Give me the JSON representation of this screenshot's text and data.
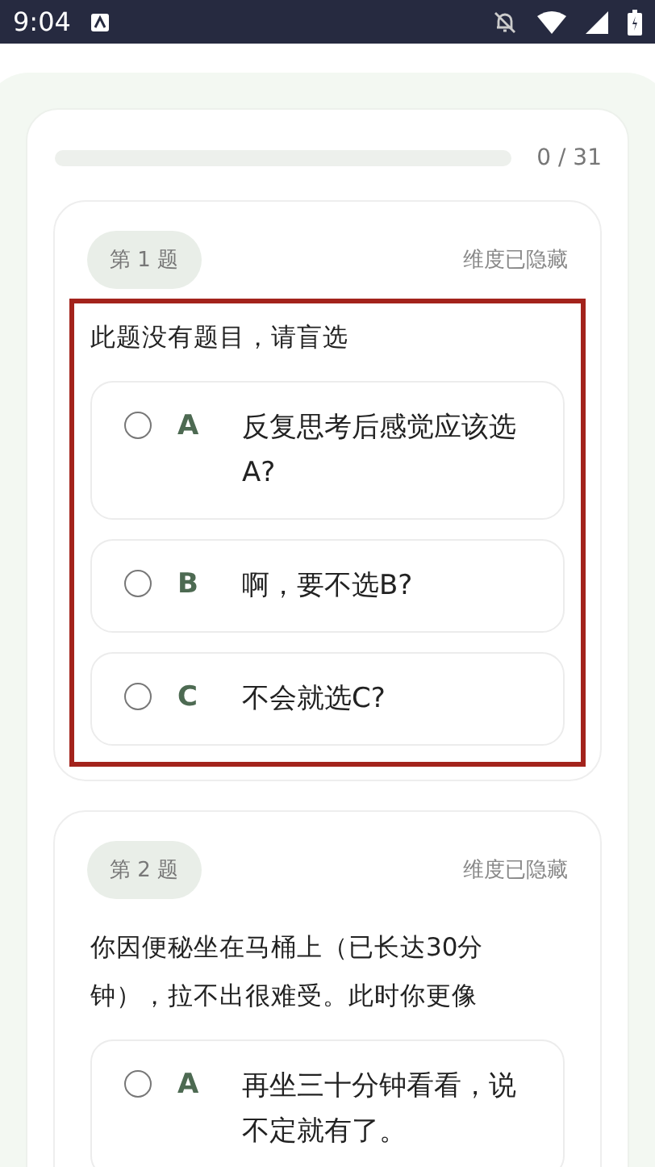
{
  "status_bar": {
    "time": "9:04"
  },
  "progress": {
    "level": 0,
    "reading": "0 / 31"
  },
  "questions": [
    {
      "number": "第 1 题",
      "dimension": "维度已隐藏",
      "text": "此题没有题目，请盲选",
      "highlighted": true,
      "options": [
        {
          "letter": "A",
          "text": "反复思考后感觉应该选A?",
          "selected": false
        },
        {
          "letter": "B",
          "text": "啊，要不选B?",
          "selected": false
        },
        {
          "letter": "C",
          "text": "不会就选C?",
          "selected": false
        }
      ]
    },
    {
      "number": "第 2 题",
      "dimension": "维度已隐藏",
      "text": "你因便秘坐在马桶上（已长达30分钟），拉不出很难受。此时你更像",
      "highlighted": false,
      "options": [
        {
          "letter": "A",
          "text": "再坐三十分钟看看，说不定就有了。",
          "selected": false
        }
      ]
    }
  ]
}
